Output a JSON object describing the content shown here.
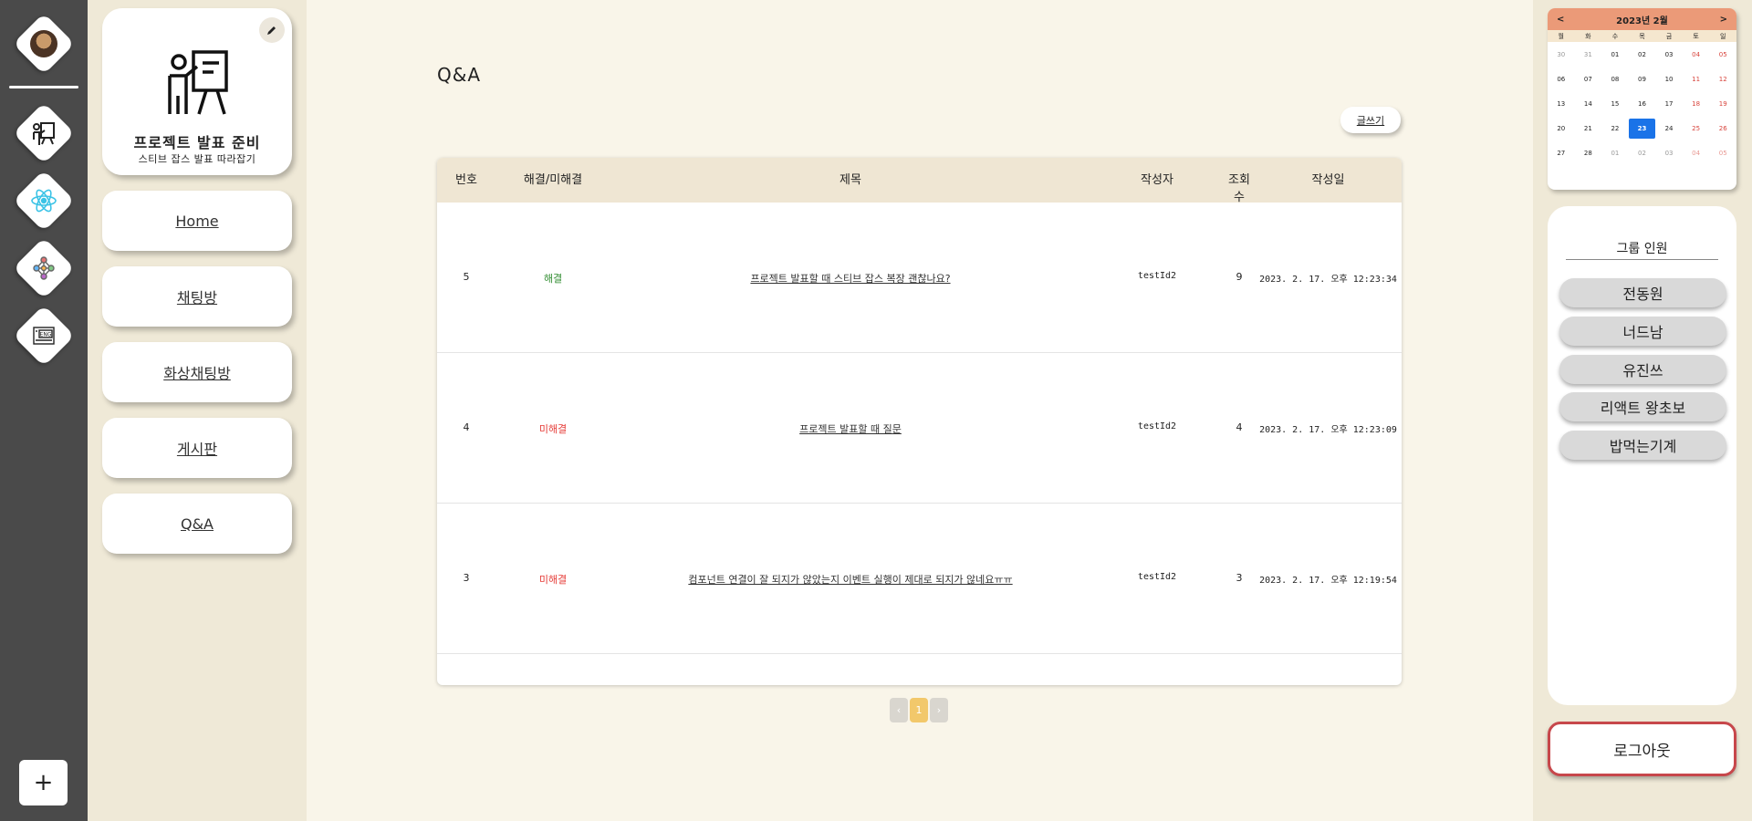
{
  "colors": {
    "resolved": "#2e8b2e",
    "unresolved": "#e53935",
    "accent": "#f2c86b",
    "today": "#1a73e8",
    "logout_border": "#c7474b"
  },
  "rail": {
    "items": [
      {
        "name": "profile-avatar",
        "icon": "avatar"
      },
      {
        "name": "group-presentation",
        "icon": "presenter-icon"
      },
      {
        "name": "group-react",
        "icon": "react-icon"
      },
      {
        "name": "group-network",
        "icon": "network-icon"
      },
      {
        "name": "group-english",
        "icon": "eng-book-icon"
      }
    ],
    "add_label": "+"
  },
  "group": {
    "name": "프로젝트 발표 준비",
    "description": "스티브 잡스 발표 따라잡기",
    "nav": [
      "Home",
      "채팅방",
      "화상채팅방",
      "게시판",
      "Q&A"
    ]
  },
  "main": {
    "title": "Q&A",
    "write_label": "글쓰기",
    "columns": [
      "번호",
      "해결/미해결",
      "제목",
      "작성자",
      "조회수",
      "작성일"
    ],
    "rows": [
      {
        "no": "5",
        "status": "해결",
        "resolved": true,
        "title": "프로젝트 발표할 때 스티브 잡스 복장 괜찮나요?",
        "author": "testId2",
        "views": "9",
        "date": "2023. 2. 17. 오후 12:23:34"
      },
      {
        "no": "4",
        "status": "미해결",
        "resolved": false,
        "title": "프로젝트 발표할 때 질문",
        "author": "testId2",
        "views": "4",
        "date": "2023. 2. 17. 오후 12:23:09"
      },
      {
        "no": "3",
        "status": "미해결",
        "resolved": false,
        "title": "컴포넌트 연결이 잘 되지가 않았는지 이벤트 실행이 제대로 되지가 않네요ㅠㅠ",
        "author": "testId2",
        "views": "3",
        "date": "2023. 2. 17. 오후 12:19:54"
      }
    ],
    "pagination": {
      "prev": "‹",
      "current": "1",
      "next": "›"
    }
  },
  "calendar": {
    "title": "2023년 2월",
    "prev": "<",
    "next": ">",
    "weekdays": [
      "월",
      "화",
      "수",
      "목",
      "금",
      "토",
      "일"
    ],
    "days": [
      "30",
      "31",
      "01",
      "02",
      "03",
      "04",
      "05",
      "06",
      "07",
      "08",
      "09",
      "10",
      "11",
      "12",
      "13",
      "14",
      "15",
      "16",
      "17",
      "18",
      "19",
      "20",
      "21",
      "22",
      "23",
      "24",
      "25",
      "26",
      "27",
      "28",
      "01",
      "02",
      "03",
      "04",
      "05"
    ],
    "other_month_indices": [
      0,
      1,
      30,
      31,
      32,
      33,
      34
    ],
    "today_index": 24
  },
  "members": {
    "title": "그룹 인원",
    "list": [
      "전동원",
      "너드남",
      "유진쓰",
      "리액트 왕초보",
      "밥먹는기계"
    ]
  },
  "logout_label": "로그아웃"
}
